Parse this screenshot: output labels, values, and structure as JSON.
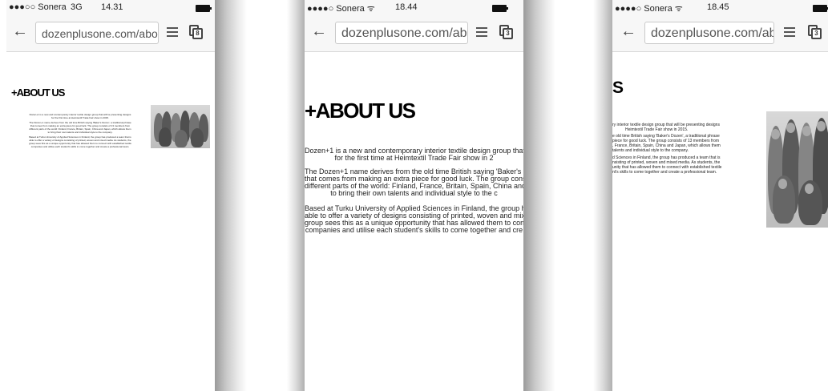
{
  "screens": [
    {
      "carrier": "●●●○○ Sonera",
      "network": "3G",
      "time": "14.31",
      "url": "dozenplusone.com/abo",
      "tab_count": "8",
      "heading": "+ABOUT US",
      "para1": [
        "Dozen+1 is a new and contemporary interior textile design group that will be presenting designs",
        "for the first time at Heimtextil Trade Fair show in 2015."
      ],
      "para2": [
        "The Dozen+1 name derives from the old time British saying 'Baker's Dozen', a traditional phrase",
        "that comes from making an extra piece for good luck. The group consists of 13 members from",
        "different parts of the world: Finland, France, Britain, Spain, China and Japan, which allows them",
        "to bring their own talents and individual style to the company."
      ],
      "para3": [
        "Based at Turku University of Applied Sciences in Finland, the group has produced a team that is",
        "able to offer a variety of designs consisting of printed, woven and mixed media. As students, the",
        "group sees this as a unique opportunity that has allowed them to connect with established textile",
        "companies and utilise each student's skills to come together and create a professional team."
      ]
    },
    {
      "carrier": "●●●●○ Sonera ᯤ",
      "time": "18.44",
      "url": "dozenplusone.com/abo",
      "tab_count": "3",
      "heading": "+ABOUT US",
      "para1": [
        "Dozen+1 is a new and contemporary interior textile design group that",
        "for the first time at Heimtextil Trade Fair show in 2"
      ],
      "para2": [
        "The Dozen+1 name derives from the old time British saying 'Baker's D",
        "that comes from making an extra piece for good luck. The group cons",
        "different parts of the world: Finland, France, Britain, Spain, China and",
        "to bring their own talents and individual style to the c"
      ],
      "para3": [
        "Based at Turku University of Applied Sciences in Finland, the group ha",
        "able to offer a variety of designs consisting of printed, woven and mixe",
        "group sees this as a unique opportunity that has allowed them to conn",
        "companies and utilise each student's skills to come together and cre"
      ]
    },
    {
      "carrier": "●●●●○ Sonera ᯤ",
      "time": "18.45",
      "url": "dozenplusone.com/abo",
      "tab_count": "3",
      "heading": "S",
      "para1": [
        "ry interior textile design group that will be presenting designs",
        "Heimtextil Trade Fair show in 2015."
      ],
      "para2": [
        "e old time British saying 'Baker's Dozen', a traditional phrase",
        "piece for good luck. The group consists of 13 members from",
        ", France, Britain, Spain, China and Japan, which allows them",
        "talents and individual style to the company."
      ],
      "para3": [
        "d Sciences in Finland, the group has produced a team that is",
        "nsisting of printed, woven and mixed media. As students, the",
        "unity that has allowed them to connect with established textile",
        "nt's skills to come together and create a professional team."
      ]
    }
  ]
}
